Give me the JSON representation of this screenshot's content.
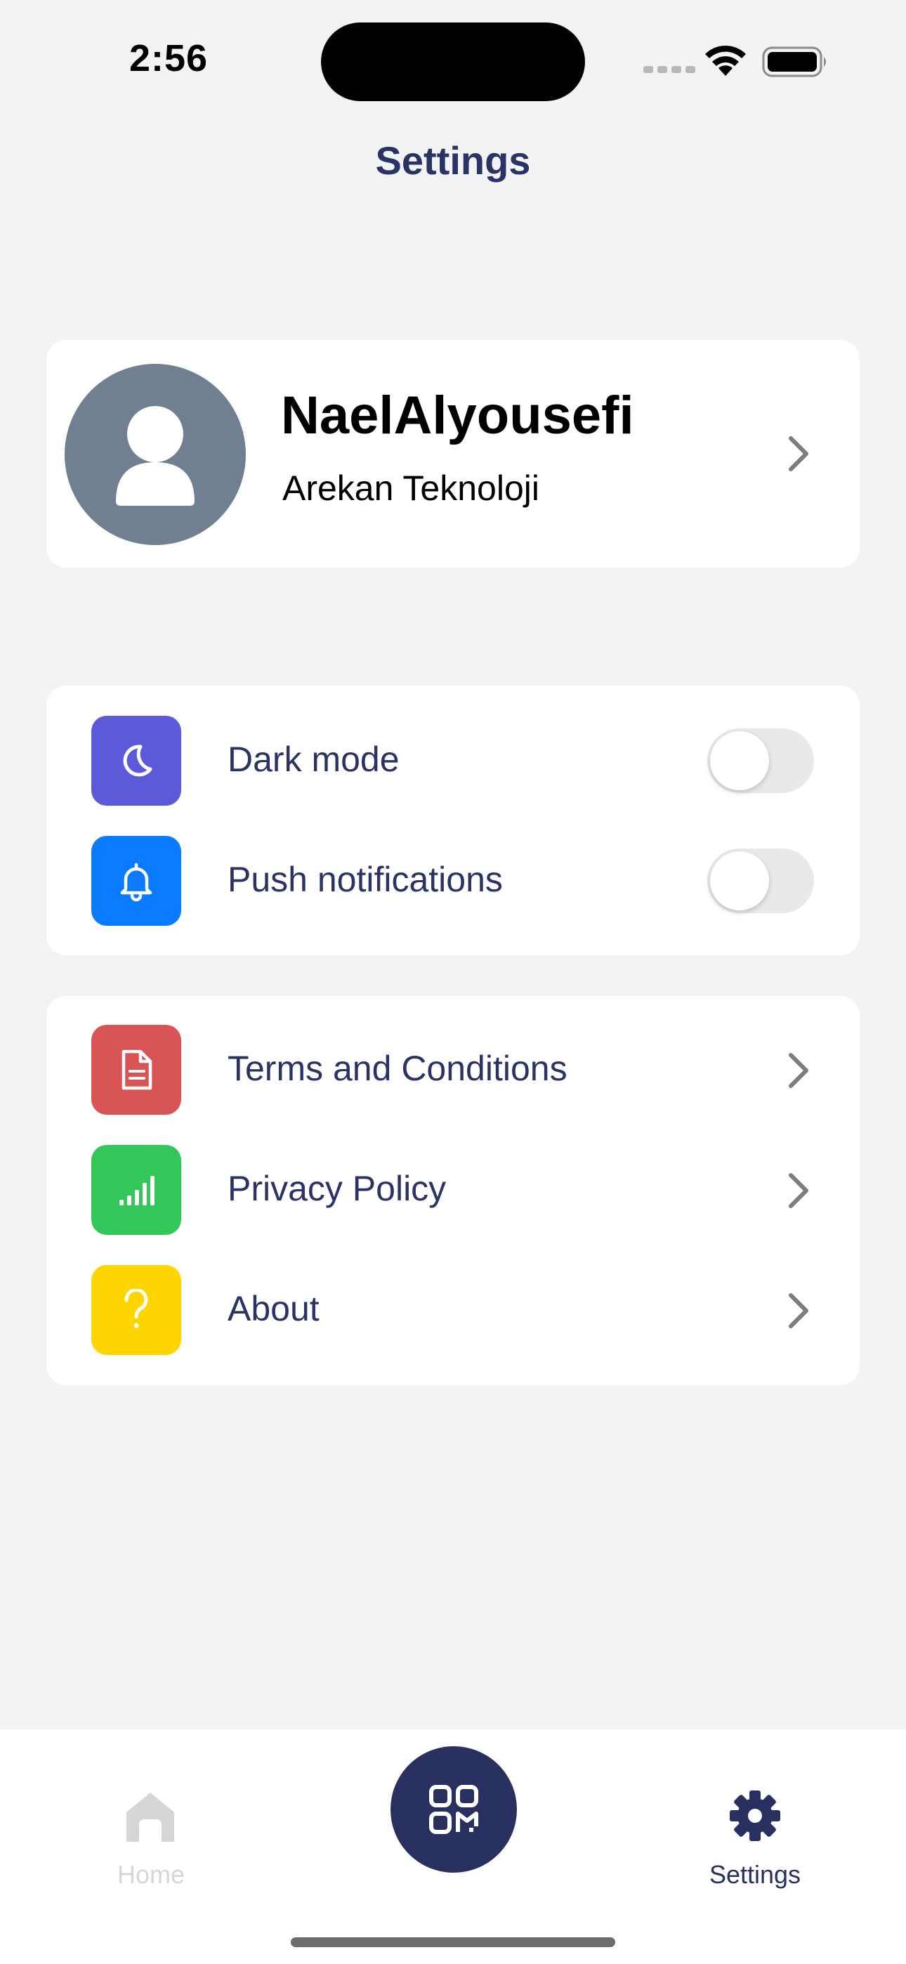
{
  "status_bar": {
    "time": "2:56"
  },
  "header": {
    "title": "Settings"
  },
  "profile": {
    "name": "NaelAlyousefi",
    "company": "Arekan Teknoloji"
  },
  "preferences": [
    {
      "label": "Dark mode",
      "icon": "moon-icon",
      "color": "#5c5ad8",
      "enabled": false
    },
    {
      "label": "Push notifications",
      "icon": "bell-icon",
      "color": "#0a7aff",
      "enabled": false
    }
  ],
  "links": [
    {
      "label": "Terms and Conditions",
      "icon": "document-icon",
      "color": "#d95454"
    },
    {
      "label": "Privacy Policy",
      "icon": "signal-bars-icon",
      "color": "#33c759"
    },
    {
      "label": "About",
      "icon": "question-icon",
      "color": "#ffd500"
    }
  ],
  "tabbar": {
    "home_label": "Home",
    "settings_label": "Settings",
    "active_tab": "Settings",
    "accent_color": "#28305f",
    "inactive_color": "#d6d6d6"
  }
}
